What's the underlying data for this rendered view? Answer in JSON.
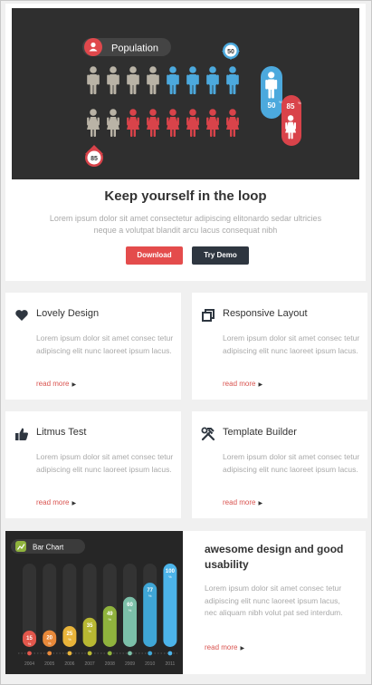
{
  "hero": {
    "pill_label": "Population",
    "badge_top": "50",
    "badge_bottom": "85",
    "male_label": "50",
    "female_label": "85",
    "title": "Keep yourself in the loop",
    "description": "Lorem ipsum dolor sit amet consectetur adipiscing elitonardo sedar ultricies neque a volutpat blandit arcu lacus consequat nibh",
    "download_label": "Download",
    "demo_label": "Try Demo"
  },
  "features": [
    {
      "icon": "heart-icon",
      "title": "Lovely Design",
      "text": "Lorem ipsum dolor sit amet consec tetur adipiscing elit nunc laoreet ipsum lacus.",
      "more": "read more"
    },
    {
      "icon": "copy-icon",
      "title": "Responsive Layout",
      "text": "Lorem ipsum dolor sit amet consec tetur adipiscing elit nunc laoreet ipsum lacus.",
      "more": "read more"
    },
    {
      "icon": "thumbs-up-icon",
      "title": "Litmus Test",
      "text": "Lorem ipsum dolor sit amet consec tetur adipiscing elit nunc laoreet ipsum lacus.",
      "more": "read more"
    },
    {
      "icon": "tools-icon",
      "title": "Template Builder",
      "text": "Lorem ipsum dolor sit amet consec tetur adipiscing elit nunc laoreet ipsum lacus.",
      "more": "read more"
    }
  ],
  "bottom": {
    "chart_label": "Bar Chart",
    "title": "awesome design and good usability",
    "text": "Lorem ipsum dolor sit amet consec tetur adipiscing elit nunc laoreet ipsum lacus, nec aliquam nibh volut pat sed interdum.",
    "more": "read more"
  },
  "chart_data": {
    "type": "bar",
    "title": "Bar Chart",
    "categories": [
      "2004",
      "2005",
      "2006",
      "2007",
      "2008",
      "2009",
      "2010",
      "2011"
    ],
    "values": [
      15,
      20,
      25,
      35,
      49,
      60,
      77,
      100
    ],
    "unit": "%",
    "colors": [
      "#e2574c",
      "#e8893a",
      "#e9b43a",
      "#b8b832",
      "#8fb33d",
      "#7bbfa8",
      "#3fa6d6",
      "#4cb4ea"
    ],
    "ylim": [
      0,
      100
    ]
  },
  "colors": {
    "accent_red": "#e44c4c",
    "dark_button": "#2e3640",
    "male_blue": "#4ca9dd",
    "female_red": "#d9434a"
  }
}
